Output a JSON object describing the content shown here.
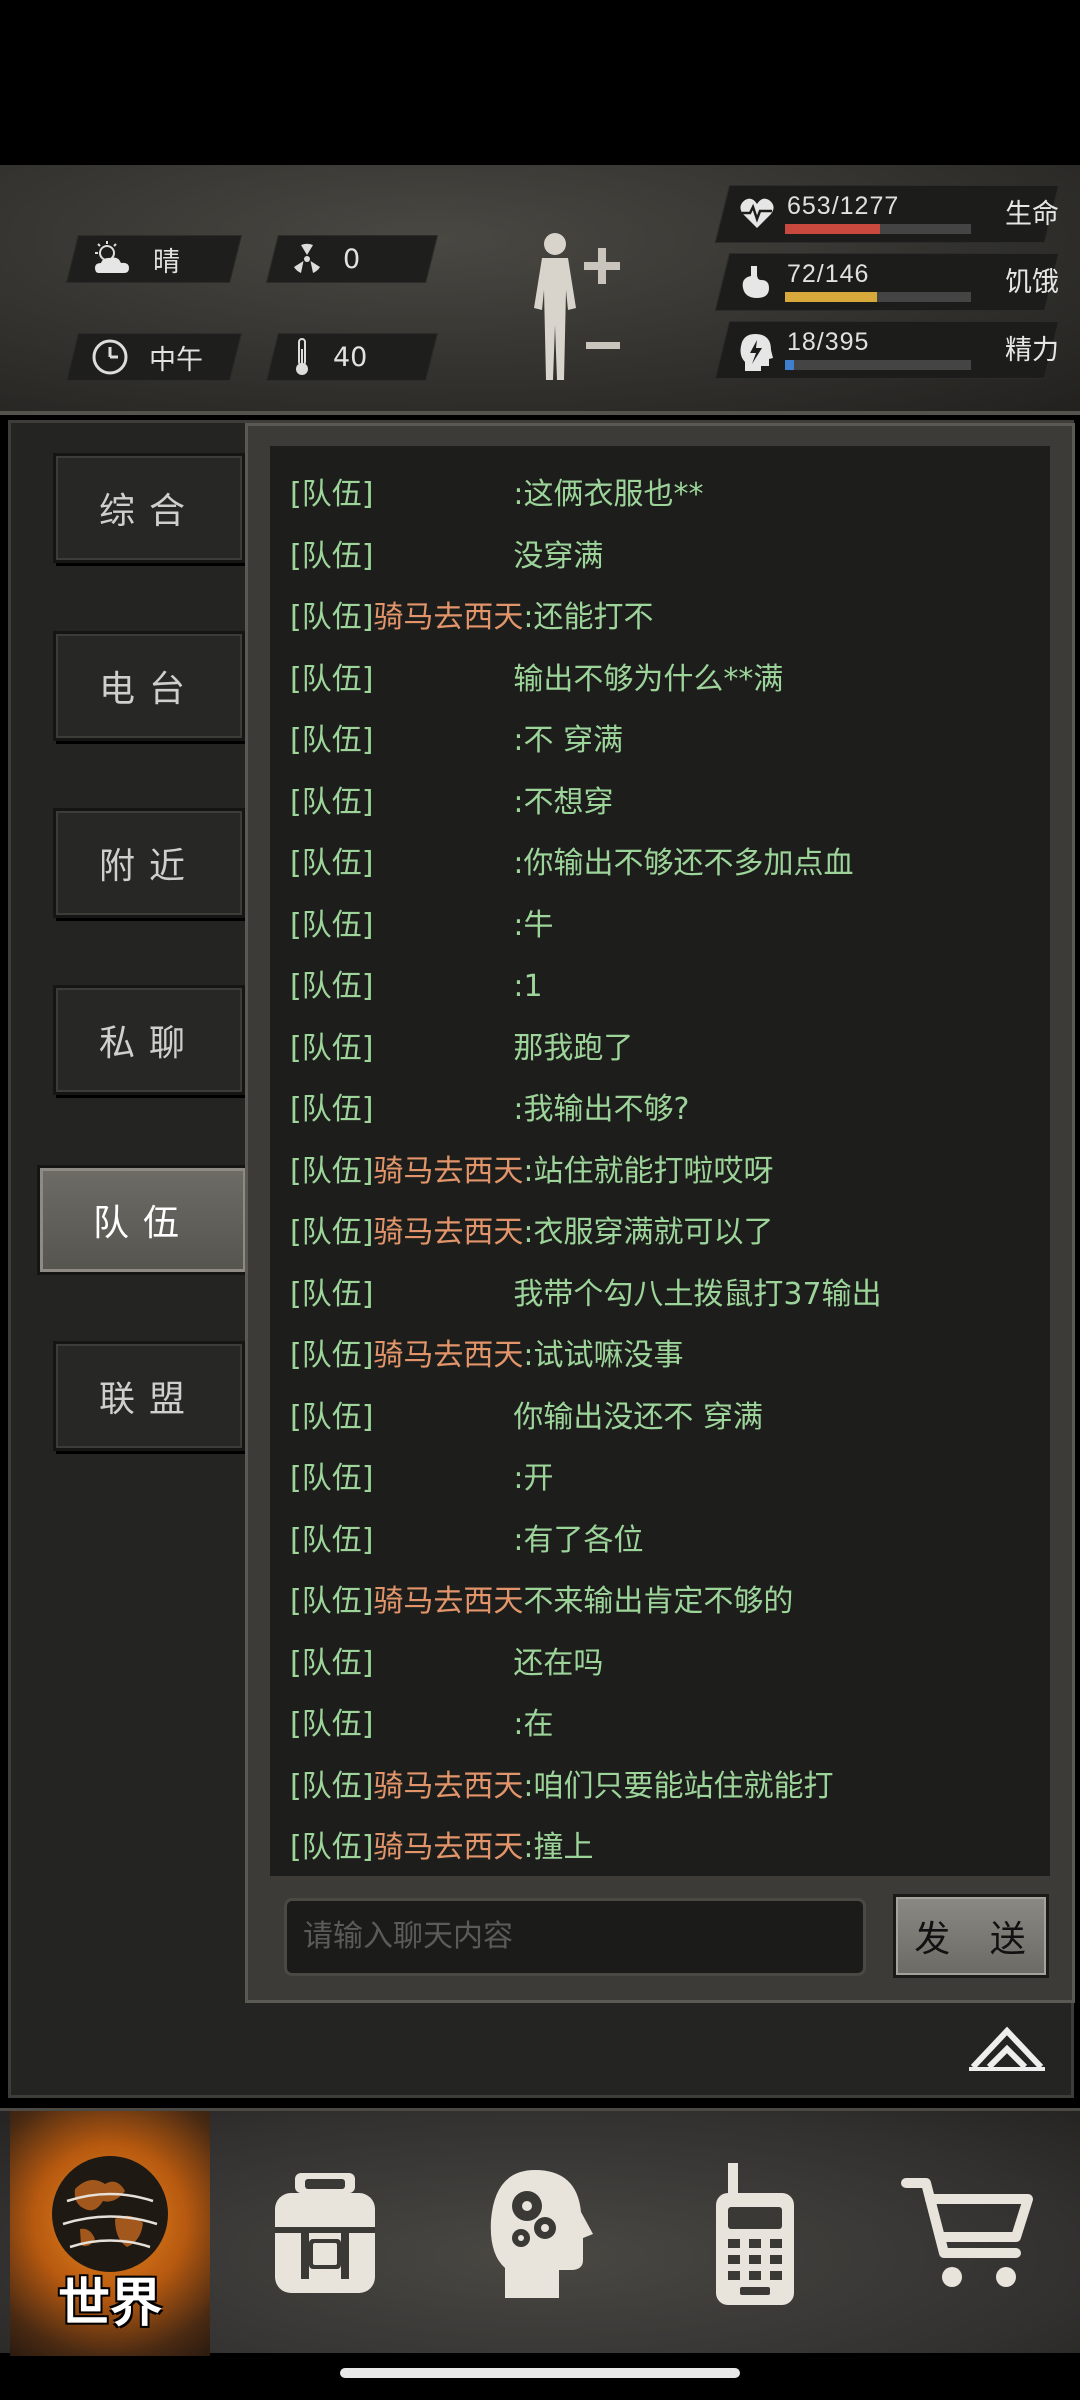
{
  "status": {
    "weather": "晴",
    "radiation": "0",
    "time_of_day": "中午",
    "temperature": "40",
    "stats": [
      {
        "label": "生命",
        "value": "653/1277",
        "fraction": 0.511,
        "color": "#c9493f",
        "icon": "heart-pulse-icon"
      },
      {
        "label": "饥饿",
        "value": "72/146",
        "fraction": 0.493,
        "color": "#d7a83a",
        "icon": "stomach-icon"
      },
      {
        "label": "精力",
        "value": "18/395",
        "fraction": 0.046,
        "color": "#3f7fd0",
        "icon": "head-energy-icon"
      }
    ]
  },
  "tabs": [
    "综合",
    "电台",
    "附近",
    "私聊",
    "队伍",
    "联盟"
  ],
  "active_tab": "队伍",
  "chat": {
    "messages": [
      {
        "tag": "[队伍]",
        "name": "",
        "text": ":这俩衣服也**"
      },
      {
        "tag": "[队伍]",
        "name": "",
        "text": "没穿满"
      },
      {
        "tag": "[队伍]",
        "name": "骑马去西天",
        "text": ":还能打不"
      },
      {
        "tag": "[队伍]",
        "name": "",
        "text": "输出不够为什么**满"
      },
      {
        "tag": "[队伍]",
        "name": "",
        "text": ":不 穿满"
      },
      {
        "tag": "[队伍]",
        "name": "",
        "text": ":不想穿"
      },
      {
        "tag": "[队伍]",
        "name": "",
        "text": ":你输出不够还不多加点血"
      },
      {
        "tag": "[队伍]",
        "name": "",
        "text": ":牛"
      },
      {
        "tag": "[队伍]",
        "name": "",
        "text": ":1"
      },
      {
        "tag": "[队伍]",
        "name": "",
        "text": "那我跑了"
      },
      {
        "tag": "[队伍]",
        "name": "",
        "text": ":我输出不够?"
      },
      {
        "tag": "[队伍]",
        "name": "骑马去西天",
        "text": ":站住就能打啦哎呀"
      },
      {
        "tag": "[队伍]",
        "name": "骑马去西天",
        "text": ":衣服穿满就可以了"
      },
      {
        "tag": "[队伍]",
        "name": "",
        "text": "我带个勾八土拨鼠打37输出"
      },
      {
        "tag": "[队伍]",
        "name": "骑马去西天",
        "text": ":试试嘛没事"
      },
      {
        "tag": "[队伍]",
        "name": "",
        "text": "你输出没还不 穿满"
      },
      {
        "tag": "[队伍]",
        "name": "",
        "text": ":开"
      },
      {
        "tag": "[队伍]",
        "name": "",
        "text": ":有了各位"
      },
      {
        "tag": "[队伍]",
        "name": "骑马去西天",
        "text": "不来输出肯定不够的"
      },
      {
        "tag": "[队伍]",
        "name": "",
        "text": "还在吗"
      },
      {
        "tag": "[队伍]",
        "name": "",
        "text": ":在"
      },
      {
        "tag": "[队伍]",
        "name": "骑马去西天",
        "text": ":咱们只要能站住就能打"
      },
      {
        "tag": "[队伍]",
        "name": "骑马去西天",
        "text": ":撞上"
      }
    ],
    "input_placeholder": "请输入聊天内容",
    "send_label": "发 送"
  },
  "bottom_nav": {
    "world_label": "世界",
    "items": [
      "globe-icon",
      "backpack-icon",
      "skills-head-icon",
      "walkie-talkie-icon",
      "cart-icon"
    ]
  }
}
